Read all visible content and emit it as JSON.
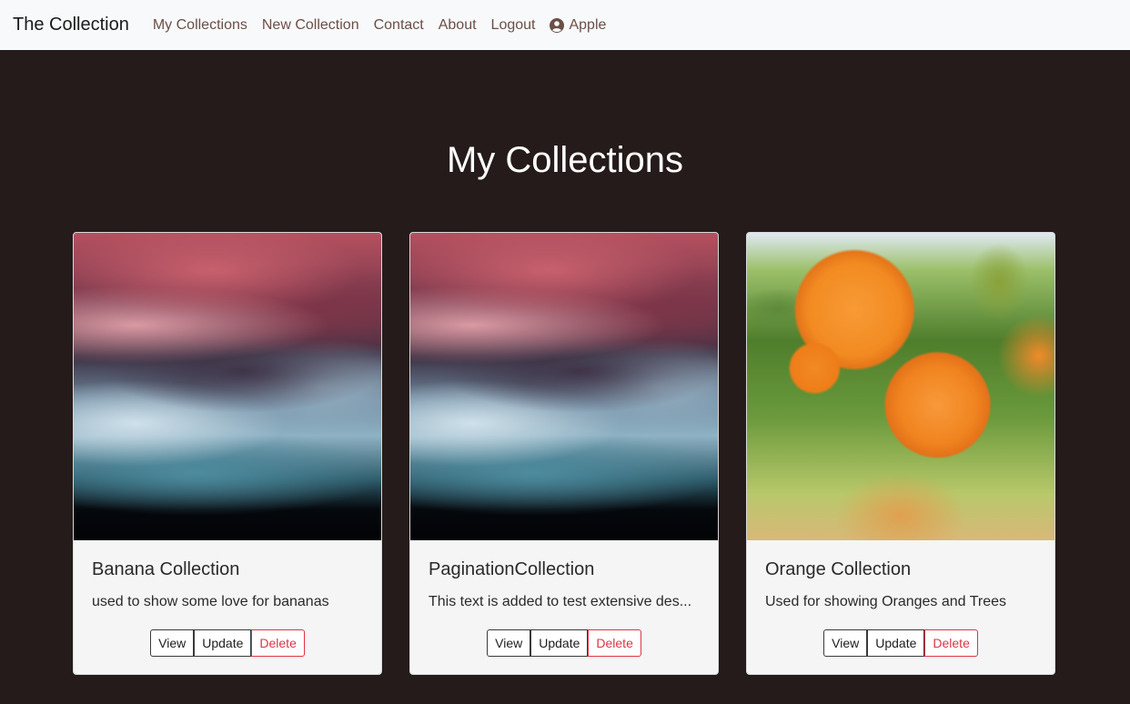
{
  "navbar": {
    "brand": "The Collection",
    "links": [
      "My Collections",
      "New Collection",
      "Contact",
      "About",
      "Logout"
    ],
    "user": {
      "icon": "user-circle-icon",
      "name": "Apple"
    }
  },
  "main": {
    "title": "My Collections",
    "collections": [
      {
        "title": "Banana Collection",
        "description": "used to show some love for bananas",
        "image": "abstract-smoke-image"
      },
      {
        "title": "PaginationCollection",
        "description": "This text is added to test extensive des...",
        "image": "abstract-smoke-image"
      },
      {
        "title": "Orange Collection",
        "description": "Used for showing Oranges and Trees",
        "image": "oranges-on-tree-image"
      }
    ],
    "buttons": {
      "view": "View",
      "update": "Update",
      "delete": "Delete"
    }
  },
  "colors": {
    "background": "#241b1a",
    "navbar": "#f8f9fa",
    "nav_link": "#6b4f47",
    "delete": "#dc3545"
  }
}
